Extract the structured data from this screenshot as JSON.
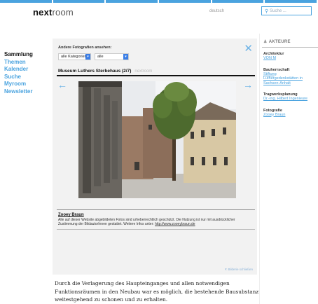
{
  "header": {
    "logo_bold": "next",
    "logo_thin": "room",
    "language": "deutsch",
    "search_placeholder": "Suche ..."
  },
  "nav": {
    "items": [
      {
        "label": "Sammlung",
        "active": true
      },
      {
        "label": "Themen",
        "active": false
      },
      {
        "label": "Kalender",
        "active": false
      },
      {
        "label": "Suche",
        "active": false
      },
      {
        "label": "Myroom",
        "active": false
      },
      {
        "label": "Newsletter",
        "active": false
      }
    ]
  },
  "gallery": {
    "other_photos_label": "Andere Fotografien ansehen:",
    "category_select": "alle Kategorien",
    "filter_select": "alle",
    "title": "Museum Luthers Sterbehaus (2/7)",
    "title_secondary": "nextroom",
    "credit_name": "Zooey Braun",
    "credit_text": "Alle auf dieser Website abgebildeten Fotos sind urheberrechtlich geschützt. Die Nutzung ist nur mit ausdrücklicher Zustimmung der BildautorInnen gestattet. Weitere Infos unter:",
    "credit_url": "http://www.zooeybraun.de",
    "close_link": "Bilderie schließen"
  },
  "sidebar": {
    "heading": "AKTEURE",
    "sections": [
      {
        "role": "Architektur",
        "names": [
          "VON M"
        ]
      },
      {
        "role": "Bauherrschaft",
        "names": [
          "Stiftung",
          "Luthergedenkstätten in",
          "Sachsen-Anhalt"
        ]
      },
      {
        "role": "Tragwerksplanung",
        "names": [
          "Dr.-Ing. Hilbert Ingenieure"
        ]
      },
      {
        "role": "Fotografie",
        "names": [
          "Zooey Braun"
        ]
      }
    ]
  },
  "body": {
    "text": "Durch die Verlagerung des Haupteinganges und allen notwendigen Funktionsräumen in den Neubau war es möglich, die bestehende Bausubstanz weitestgehend zu schonen und zu erhalten."
  }
}
